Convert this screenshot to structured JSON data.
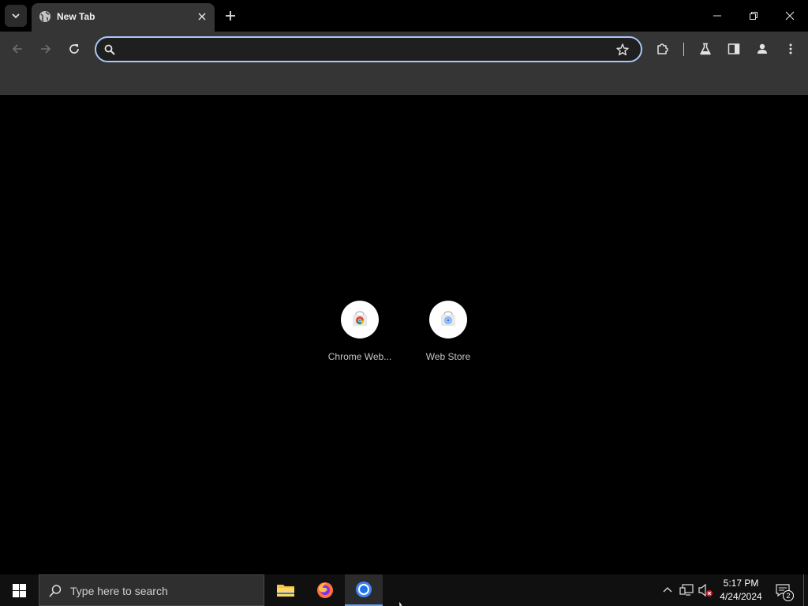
{
  "tabs": [
    {
      "title": "New Tab",
      "favicon": "globe-icon",
      "active": true
    }
  ],
  "toolbar": {
    "omnibox_value": "",
    "omnibox_placeholder": ""
  },
  "shortcuts": [
    {
      "label": "Chrome Web...",
      "icon": "chrome-web-store-icon"
    },
    {
      "label": "Web Store",
      "icon": "web-store-icon"
    }
  ],
  "taskbar": {
    "search_placeholder": "Type here to search",
    "apps": [
      "file-explorer",
      "firefox",
      "chrome"
    ],
    "active_app": "chrome",
    "time": "5:17 PM",
    "date": "4/24/2024",
    "notification_count": "2"
  },
  "colors": {
    "omnibox_focus": "#a8c7fa",
    "toolbar_bg": "#353535",
    "taskbar_bg": "#101010",
    "active_app_indicator": "#6ea0e6"
  }
}
